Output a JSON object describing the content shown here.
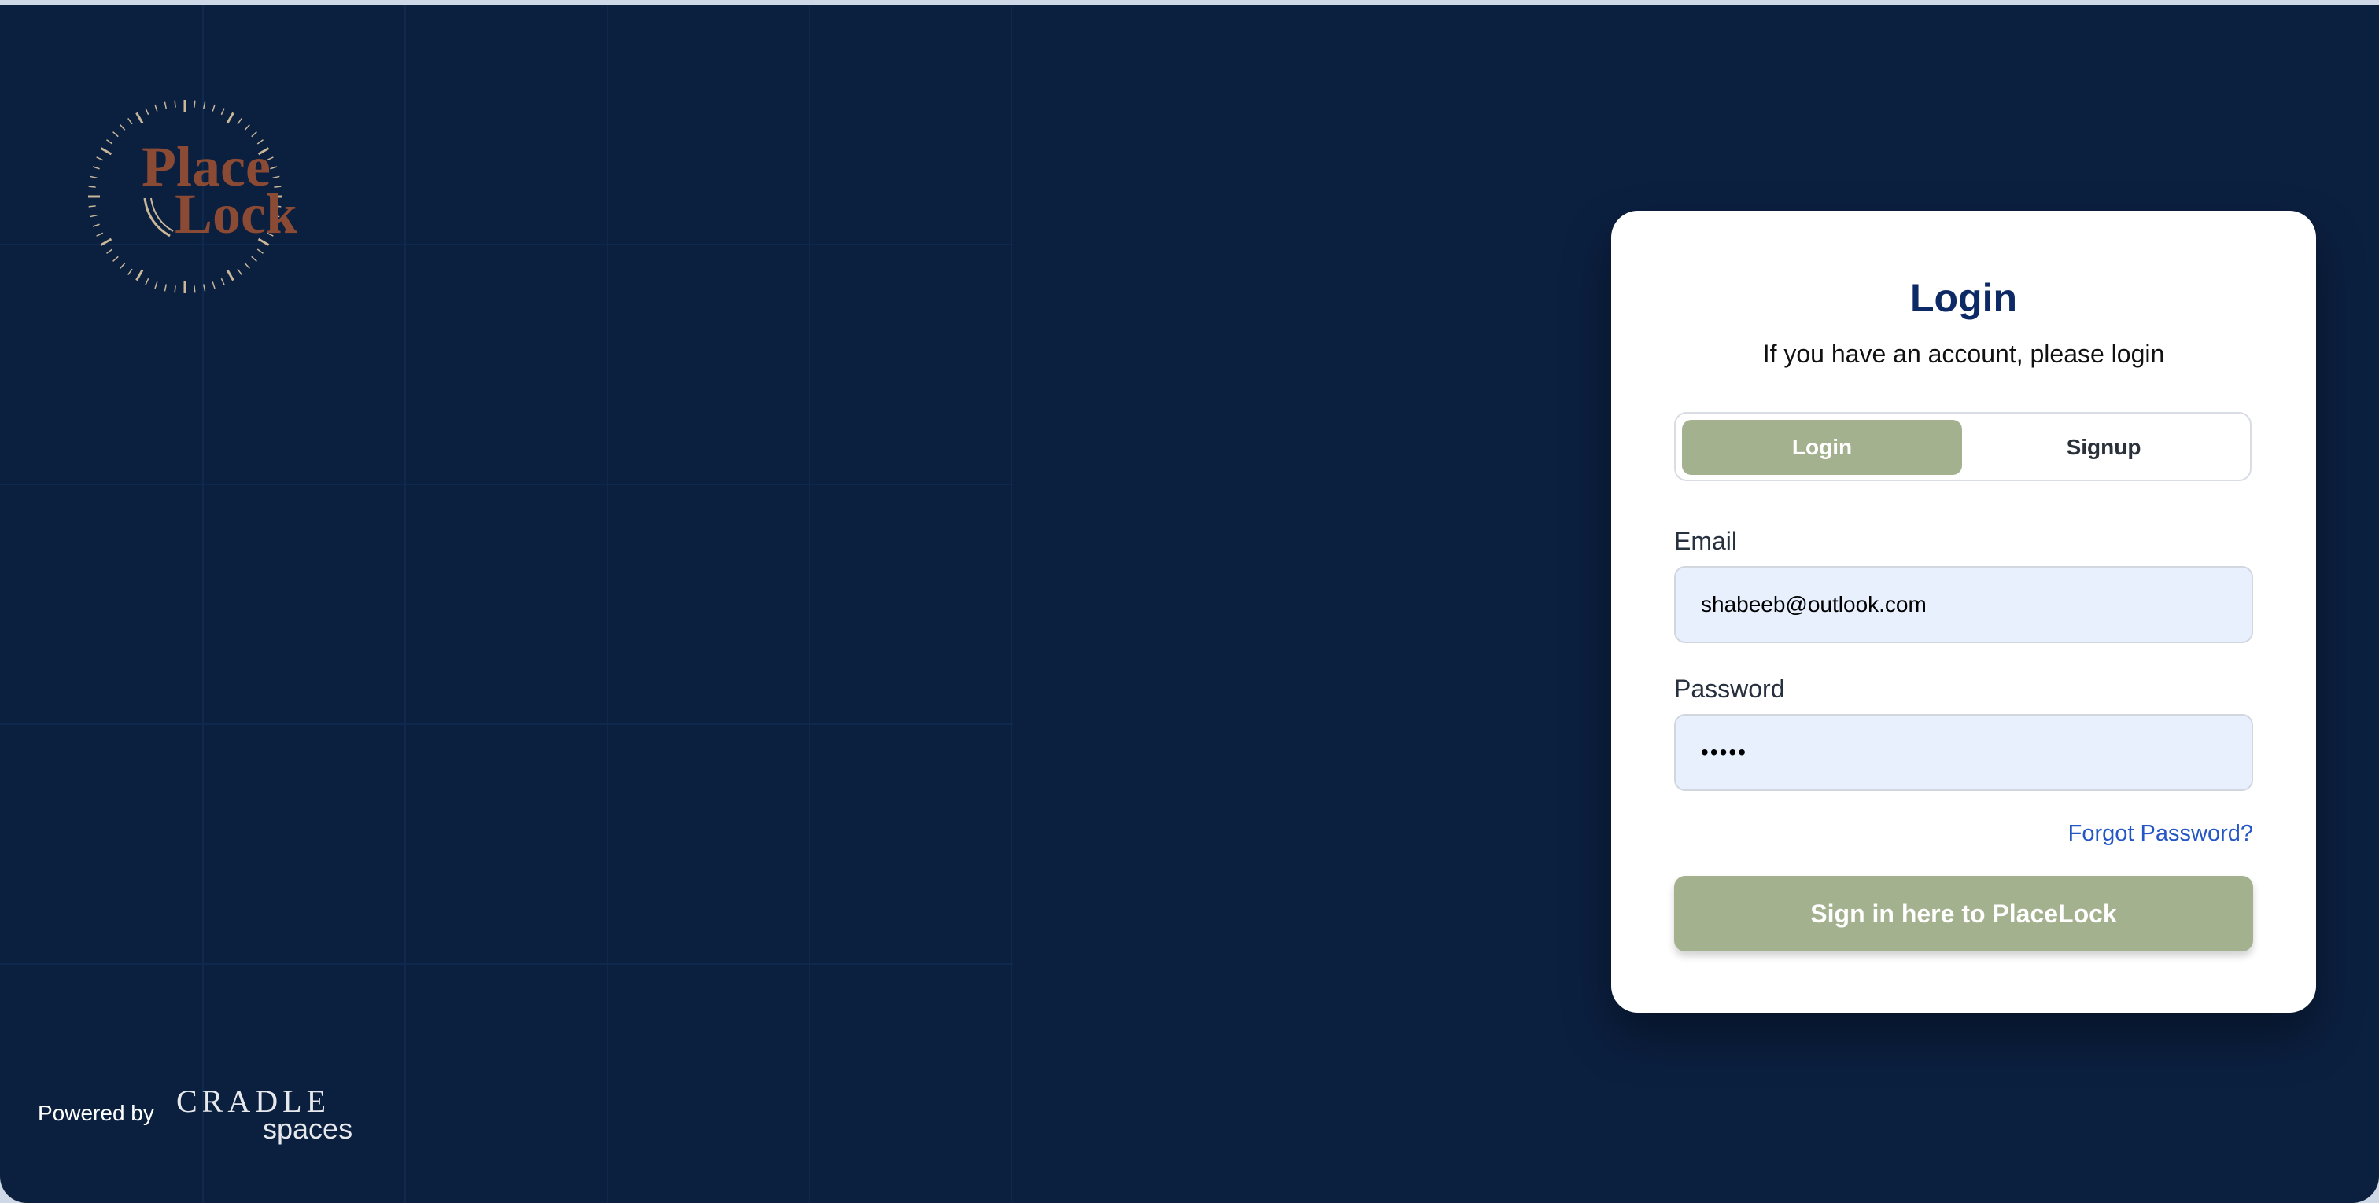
{
  "brand": {
    "logo_line1": "Place",
    "logo_line2": "Lock",
    "logo_color": "#8b4a33",
    "powered_by_label": "Powered by",
    "partner_logo_line1": "CRADLE",
    "partner_logo_line2": "spaces"
  },
  "colors": {
    "background": "#0b1f3f",
    "accent": "#a3b18f",
    "title": "#0d2a66",
    "link": "#2457c5",
    "input_bg": "#e8f0fe"
  },
  "login_card": {
    "title": "Login",
    "subtitle": "If you have an account, please login",
    "tabs": [
      {
        "label": "Login",
        "active": true
      },
      {
        "label": "Signup",
        "active": false
      }
    ],
    "email": {
      "label": "Email",
      "value": "shabeeb@outlook.com"
    },
    "password": {
      "label": "Password",
      "value": "•••••"
    },
    "forgot_password": "Forgot Password?",
    "submit_label": "Sign in here to PlaceLock"
  }
}
